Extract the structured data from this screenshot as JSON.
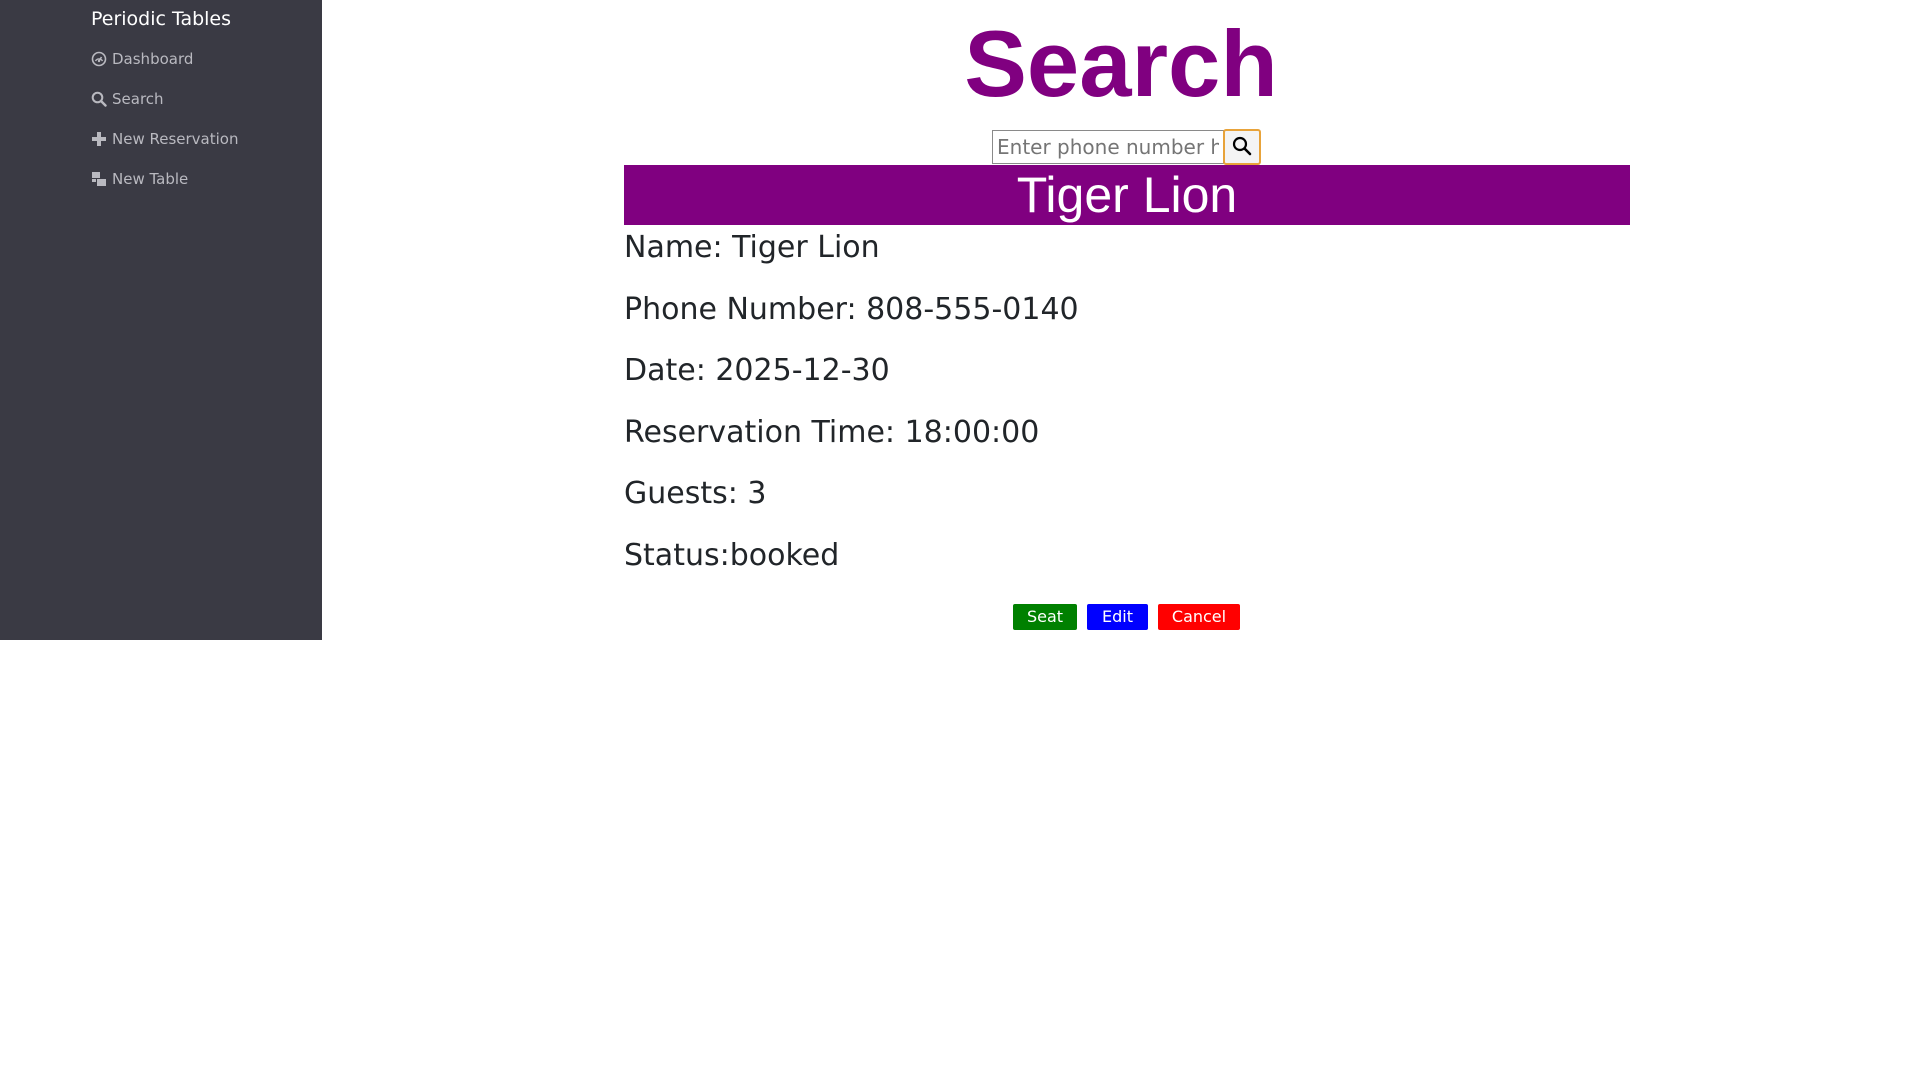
{
  "sidebar": {
    "brand": "Periodic Tables",
    "items": [
      {
        "label": "Dashboard",
        "icon": "dashboard-icon"
      },
      {
        "label": "Search",
        "icon": "search-icon"
      },
      {
        "label": "New Reservation",
        "icon": "plus-icon"
      },
      {
        "label": "New Table",
        "icon": "table-icon"
      }
    ]
  },
  "page": {
    "title": "Search"
  },
  "search": {
    "placeholder": "Enter phone number here",
    "value": "",
    "button_icon": "search-icon"
  },
  "reservation": {
    "header": "Tiger Lion",
    "name_line": "Name: Tiger Lion",
    "phone_line": "Phone Number: 808-555-0140",
    "date_line": "Date: 2025-12-30",
    "time_line": "Reservation Time: 18:00:00",
    "guests_line": "Guests: 3",
    "status_line": "Status:booked"
  },
  "actions": {
    "seat_label": "Seat",
    "edit_label": "Edit",
    "cancel_label": "Cancel"
  },
  "colors": {
    "sidebar_bg": "#3a3a44",
    "accent": "#800080",
    "seat": "#008000",
    "edit": "#0000ff",
    "cancel": "#ff0000"
  }
}
